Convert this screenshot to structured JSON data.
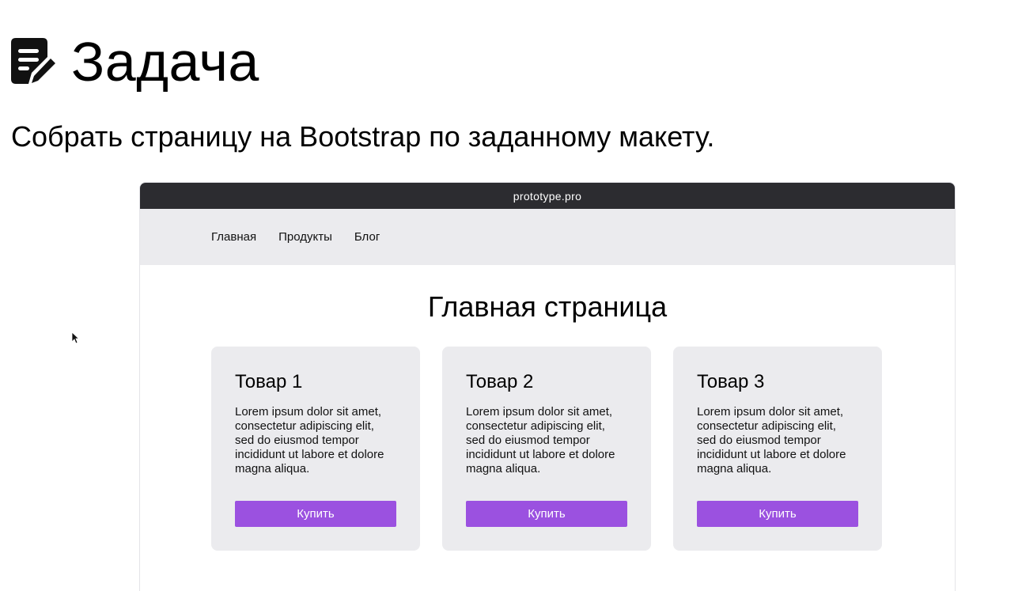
{
  "slide": {
    "title": "Задача",
    "description": "Собрать страницу на Bootstrap по заданному макету.",
    "title_icon": "edit-note-icon"
  },
  "mockup": {
    "browser_url": "prototype.pro",
    "nav": [
      {
        "label": "Главная"
      },
      {
        "label": "Продукты"
      },
      {
        "label": "Блог"
      }
    ],
    "page_heading": "Главная страница",
    "cards": [
      {
        "title": "Товар 1",
        "text": "Lorem ipsum dolor sit amet, consectetur adipiscing elit, sed do eiusmod tempor incididunt ut labore et dolore magna aliqua.",
        "button": "Купить"
      },
      {
        "title": "Товар 2",
        "text": "Lorem ipsum dolor sit amet, consectetur adipiscing elit, sed do eiusmod tempor incididunt ut labore et dolore magna aliqua.",
        "button": "Купить"
      },
      {
        "title": "Товар 3",
        "text": "Lorem ipsum dolor sit amet, consectetur adipiscing elit, sed do eiusmod tempor incididunt ut labore et dolore magna aliqua.",
        "button": "Купить"
      }
    ]
  },
  "colors": {
    "browser_bar": "#2c2c30",
    "nav_background": "#ebebee",
    "card_background": "#ebebee",
    "button_accent": "#9b51e0"
  }
}
